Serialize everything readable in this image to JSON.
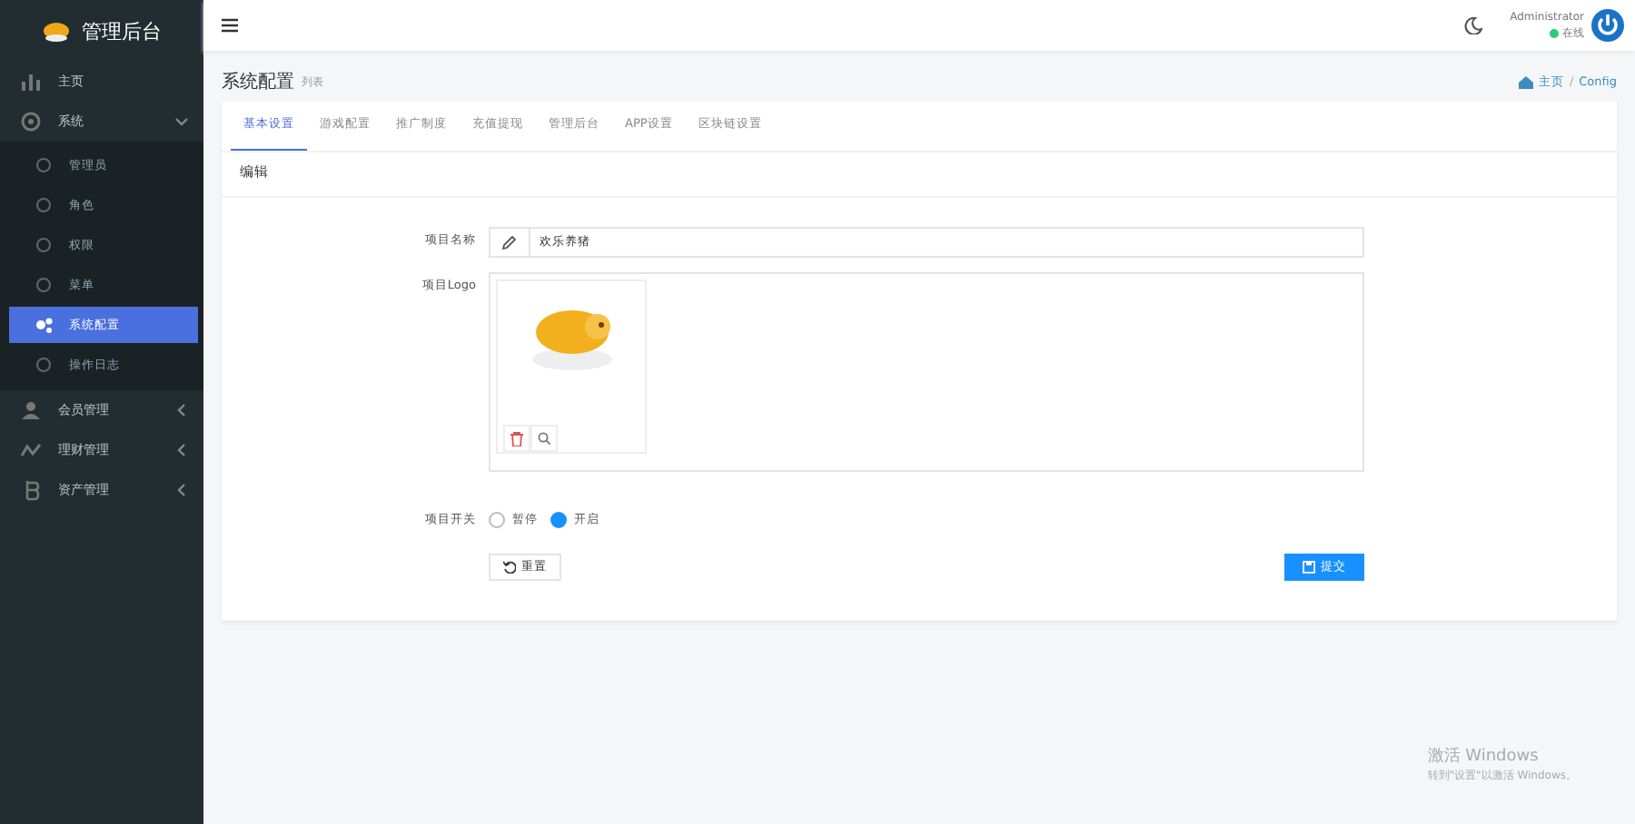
{
  "brand": {
    "title": "管理后台"
  },
  "sidebar": {
    "items": [
      {
        "label": "主页",
        "kind": "link",
        "selected": false
      },
      {
        "label": "系统",
        "kind": "group",
        "expanded": true,
        "selected": false,
        "children": [
          {
            "label": "管理员",
            "selected": false
          },
          {
            "label": "角色",
            "selected": false
          },
          {
            "label": "权限",
            "selected": false
          },
          {
            "label": "菜单",
            "selected": false
          },
          {
            "label": "系统配置",
            "selected": true
          },
          {
            "label": "操作日志",
            "selected": false
          }
        ]
      },
      {
        "label": "会员管理",
        "kind": "group",
        "expanded": false,
        "selected": false
      },
      {
        "label": "理财管理",
        "kind": "group",
        "expanded": false,
        "selected": false
      },
      {
        "label": "资产管理",
        "kind": "group",
        "expanded": false,
        "selected": false
      }
    ]
  },
  "header": {
    "user": "Administrator",
    "status": "在线"
  },
  "page": {
    "title": "系统配置",
    "subtitle": "列表",
    "breadcrumb": [
      "主页",
      "Config"
    ],
    "breadcrumb_separator": "/"
  },
  "tabs": [
    {
      "label": "基本设置",
      "selected": true
    },
    {
      "label": "游戏配置",
      "selected": false
    },
    {
      "label": "推广制度",
      "selected": false
    },
    {
      "label": "充值提现",
      "selected": false
    },
    {
      "label": "管理后台",
      "selected": false
    },
    {
      "label": "APP设置",
      "selected": false
    },
    {
      "label": "区块链设置",
      "selected": false
    }
  ],
  "panel": {
    "title": "编辑"
  },
  "form": {
    "name_label": "项目名称",
    "name_value": "欢乐养猪",
    "logo_label": "项目Logo",
    "switch_label": "项目开关",
    "options": [
      {
        "label": "暂停",
        "selected": false
      },
      {
        "label": "开启",
        "selected": true
      }
    ],
    "reset": "重置",
    "submit": "提交"
  },
  "os_notice": {
    "title": "激活 Windows",
    "text": "转到\"设置\"以激活 Windows。"
  }
}
